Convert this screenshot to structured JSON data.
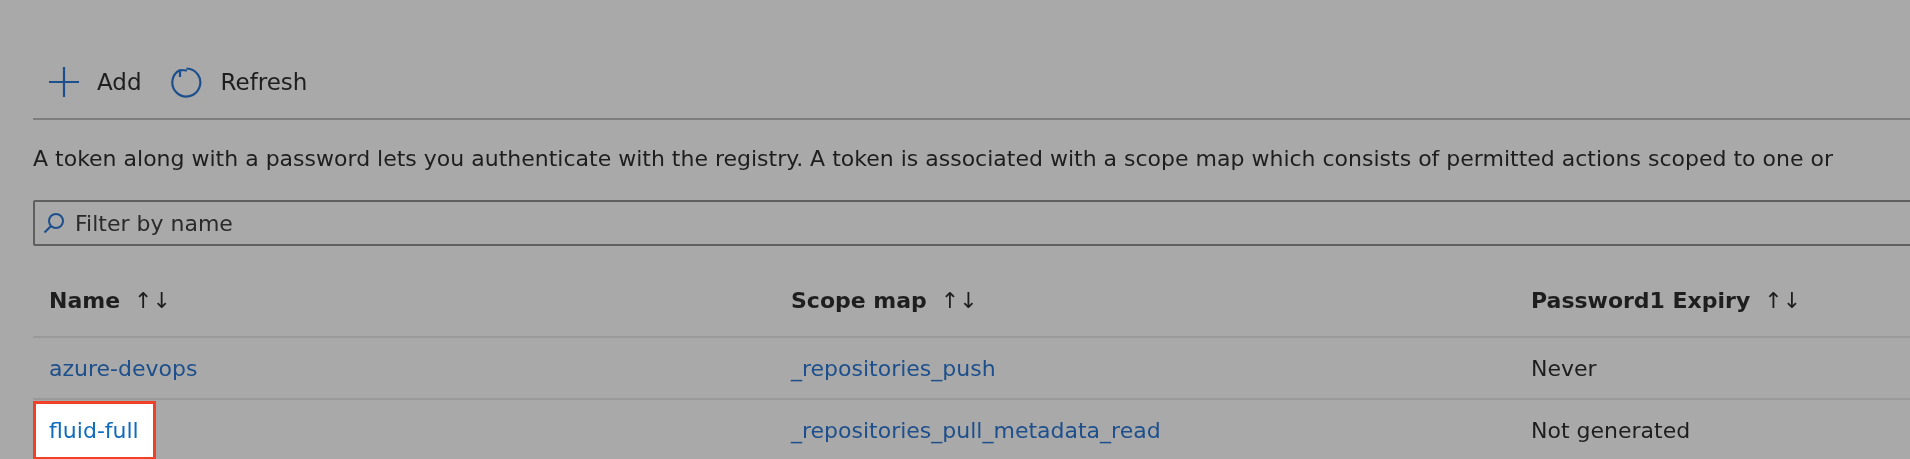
{
  "toolbar": [
    {
      "kind": "add",
      "label": "Add"
    },
    {
      "kind": "refresh",
      "label": "Refresh"
    }
  ],
  "description": "A token along with a password lets you authenticate with the registry. A token is associated with a scope map which consists of permitted actions scoped to one or",
  "filter": {
    "placeholder": "Filter by name"
  },
  "table": {
    "columns": [
      {
        "label": "Name",
        "sort": "↑↓"
      },
      {
        "label": "Scope map",
        "sort": "↑↓"
      },
      {
        "label": "Password1 Expiry",
        "sort": "↑↓"
      }
    ],
    "rows": [
      {
        "name": "azure-devops",
        "scope_map": "_repositories_push",
        "expiry": "Never",
        "highlighted": false
      },
      {
        "name": "fluid-full",
        "scope_map": "_repositories_pull_metadata_read",
        "expiry": "Not generated",
        "highlighted": true
      }
    ]
  }
}
